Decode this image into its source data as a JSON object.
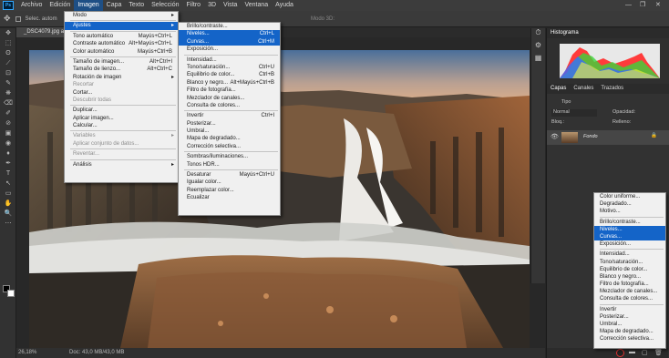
{
  "app": {
    "logo": "Ps",
    "menus": [
      "Archivo",
      "Edición",
      "Imagen",
      "Capa",
      "Texto",
      "Selección",
      "Filtro",
      "3D",
      "Vista",
      "Ventana",
      "Ayuda"
    ],
    "window_controls": [
      "—",
      "❐",
      "✕"
    ]
  },
  "options_bar": {
    "label": "Selec. autom",
    "mode": "Modo 3D:"
  },
  "document": {
    "tab": "_DSC4079.jpg al 2",
    "zoom": "26,18%",
    "doc_info": "Doc: 43,0 MB/43,0 MB"
  },
  "tools": [
    "✥",
    "⬚",
    "ʘ",
    "⟋",
    "⊡",
    "✎",
    "❋",
    "⌫",
    "✐",
    "⊘",
    "▣",
    "◉",
    "♦",
    "✒",
    "T",
    "↖",
    "▭",
    "✋",
    "🔍",
    "⋯"
  ],
  "imagen_menu": {
    "items": [
      {
        "label": "Modo",
        "arrow": true
      },
      {
        "sep": true
      },
      {
        "label": "Ajustes",
        "arrow": true,
        "highlight": true
      },
      {
        "sep": true
      },
      {
        "label": "Tono automático",
        "shortcut": "Mayús+Ctrl+L"
      },
      {
        "label": "Contraste automático",
        "shortcut": "Alt+Mayús+Ctrl+L"
      },
      {
        "label": "Color automático",
        "shortcut": "Mayús+Ctrl+B"
      },
      {
        "sep": true
      },
      {
        "label": "Tamaño de imagen...",
        "shortcut": "Alt+Ctrl+I"
      },
      {
        "label": "Tamaño de lienzo...",
        "shortcut": "Alt+Ctrl+C"
      },
      {
        "label": "Rotación de imagen",
        "arrow": true
      },
      {
        "label": "Recortar",
        "disabled": true
      },
      {
        "label": "Cortar...",
        "disabled": false
      },
      {
        "label": "Descubrir todas",
        "disabled": true
      },
      {
        "sep": true
      },
      {
        "label": "Duplicar..."
      },
      {
        "label": "Aplicar imagen..."
      },
      {
        "label": "Calcular..."
      },
      {
        "sep": true
      },
      {
        "label": "Variables",
        "arrow": true,
        "disabled": true
      },
      {
        "label": "Aplicar conjunto de datos...",
        "disabled": true
      },
      {
        "sep": true
      },
      {
        "label": "Reventar...",
        "disabled": true
      },
      {
        "sep": true
      },
      {
        "label": "Análisis",
        "arrow": true
      }
    ]
  },
  "ajustes_menu": {
    "items": [
      {
        "label": "Brillo/contraste..."
      },
      {
        "label": "Niveles...",
        "shortcut": "Ctrl+L",
        "highlight": true
      },
      {
        "label": "Curvas...",
        "shortcut": "Ctrl+M",
        "highlight": true
      },
      {
        "label": "Exposición..."
      },
      {
        "sep": true
      },
      {
        "label": "Intensidad..."
      },
      {
        "label": "Tono/saturación...",
        "shortcut": "Ctrl+U"
      },
      {
        "label": "Equilibrio de color...",
        "shortcut": "Ctrl+B"
      },
      {
        "label": "Blanco y negro...",
        "shortcut": "Alt+Mayús+Ctrl+B"
      },
      {
        "label": "Filtro de fotografía..."
      },
      {
        "label": "Mezclador de canales..."
      },
      {
        "label": "Consulta de colores..."
      },
      {
        "sep": true
      },
      {
        "label": "Invertir",
        "shortcut": "Ctrl+I"
      },
      {
        "label": "Posterizar..."
      },
      {
        "label": "Umbral..."
      },
      {
        "label": "Mapa de degradado..."
      },
      {
        "label": "Corrección selectiva..."
      },
      {
        "sep": true
      },
      {
        "label": "Sombras/iluminaciones..."
      },
      {
        "label": "Tonos HDR..."
      },
      {
        "sep": true
      },
      {
        "label": "Desaturar",
        "shortcut": "Mayús+Ctrl+U"
      },
      {
        "label": "Igualar color..."
      },
      {
        "label": "Reemplazar color..."
      },
      {
        "label": "Ecualizar"
      }
    ]
  },
  "right_panel": {
    "histogram_tab": "Histograma",
    "layers_tabs": [
      "Capas",
      "Canales",
      "Trazados"
    ],
    "kind_label": "Tipo",
    "blend_mode": "Normal",
    "opacity_label": "Opacidad:",
    "lock_label": "Bloq.:",
    "fill_label": "Relleno:",
    "layer_name": "Fondo"
  },
  "layer_adjust_menu": {
    "items": [
      {
        "label": "Color uniforme..."
      },
      {
        "label": "Degradado..."
      },
      {
        "label": "Motivo..."
      },
      {
        "sep": true
      },
      {
        "label": "Brillo/contraste..."
      },
      {
        "label": "Niveles...",
        "highlight": true
      },
      {
        "label": "Curvas...",
        "highlight": true
      },
      {
        "label": "Exposición..."
      },
      {
        "sep": true
      },
      {
        "label": "Intensidad..."
      },
      {
        "label": "Tono/saturación..."
      },
      {
        "label": "Equilibrio de color..."
      },
      {
        "label": "Blanco y negro..."
      },
      {
        "label": "Filtro de fotografía..."
      },
      {
        "label": "Mezclador de canales..."
      },
      {
        "label": "Consulta de colores..."
      },
      {
        "sep": true
      },
      {
        "label": "Invertir"
      },
      {
        "label": "Posterizar..."
      },
      {
        "label": "Umbral..."
      },
      {
        "label": "Mapa de degradado..."
      },
      {
        "label": "Corrección selectiva..."
      }
    ]
  }
}
